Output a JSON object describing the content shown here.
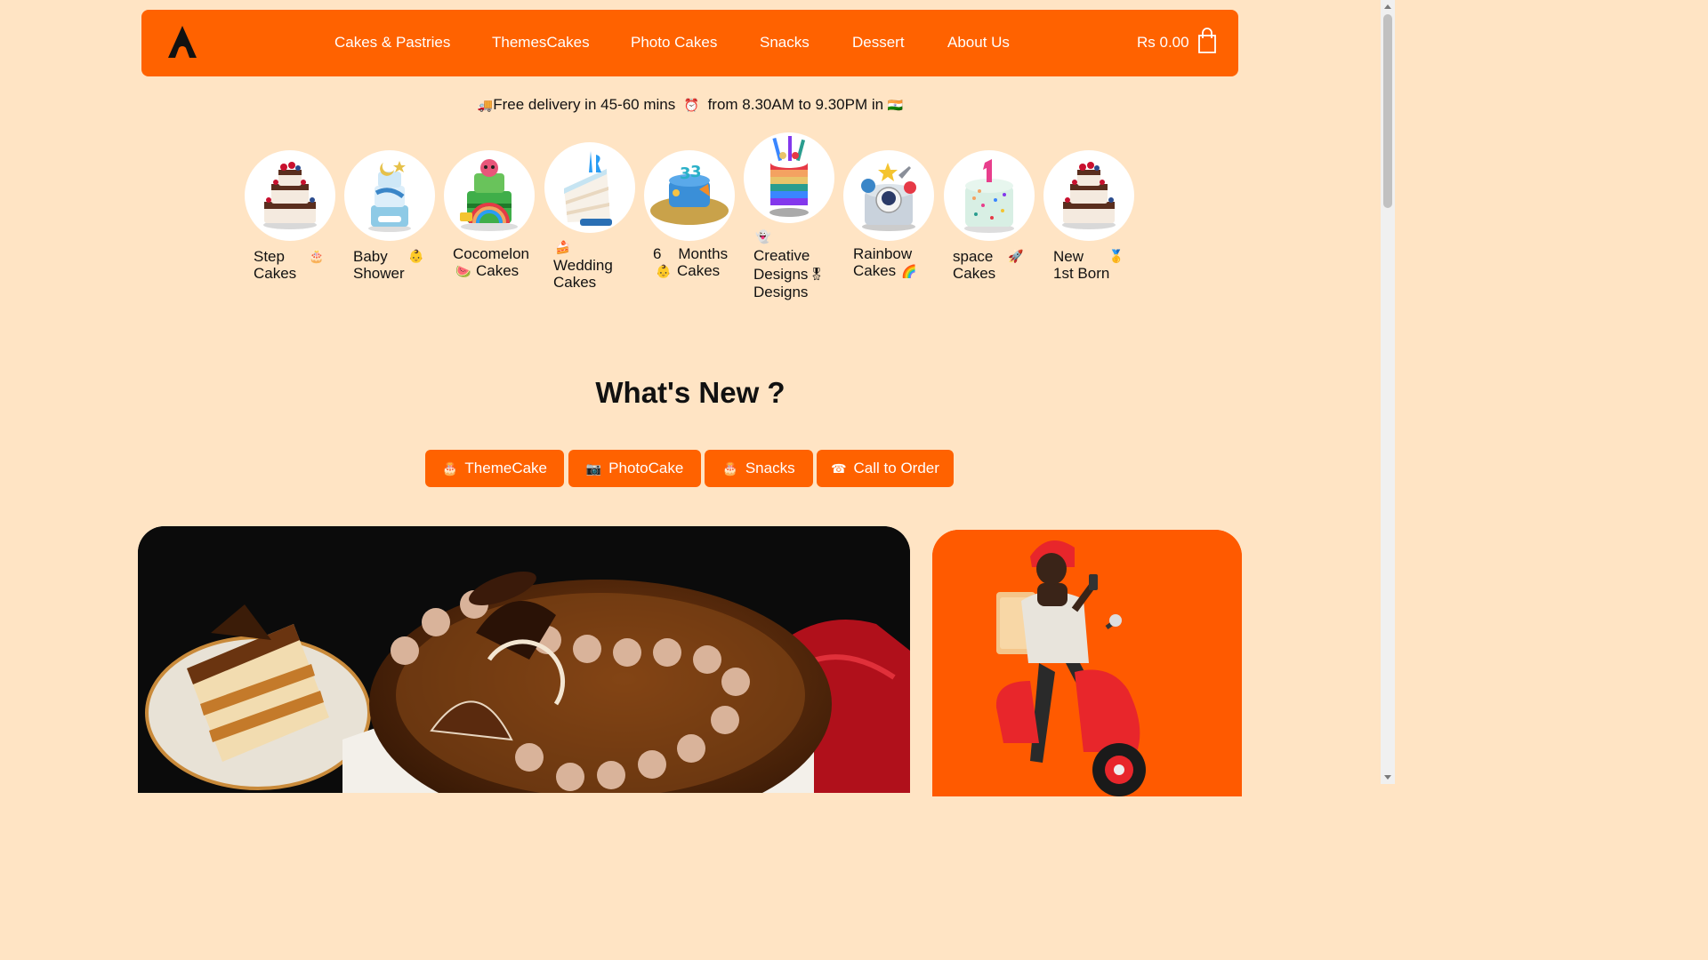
{
  "nav": {
    "logo": "A",
    "items": [
      "Cakes & Pastries",
      "ThemesCakes",
      "Photo Cakes",
      "Snacks",
      "Dessert",
      "About Us"
    ],
    "cart_total": "Rs 0.00"
  },
  "delivery": {
    "truck_emoji": "🚚",
    "text1": "Free delivery in 45-60 mins",
    "clock_emoji": "⏰",
    "text2": "from 8.30AM to 9.30PM in",
    "flag_emoji": "🇮🇳"
  },
  "categories": [
    {
      "line1": "Step",
      "line2": "Cakes",
      "emoji": "🎂"
    },
    {
      "line1": "Baby",
      "line2": "Shower",
      "emoji": "👶"
    },
    {
      "line1": "Cocomelon",
      "line2": "Cakes",
      "emoji": "🍉"
    },
    {
      "line1": "Wedding",
      "line2": "Cakes",
      "emoji": "🍰"
    },
    {
      "line1": "6    Months",
      "line2": "Cakes",
      "emoji": "👶"
    },
    {
      "line1": "Creative",
      "line2": "Designs",
      "line3": "Designs",
      "emoji": "👻",
      "emoji2": "🎖"
    },
    {
      "line1": "Rainbow",
      "line2": "Cakes",
      "emoji": "🌈"
    },
    {
      "line1": "space",
      "line2": "Cakes",
      "emoji": "🚀"
    },
    {
      "line1": "New",
      "line2": "1st Born",
      "emoji": "🥇"
    }
  ],
  "section": {
    "title": "What's New ?"
  },
  "pills": [
    {
      "emoji": "🎂",
      "label": "ThemeCake"
    },
    {
      "emoji": "📷",
      "label": "PhotoCake"
    },
    {
      "emoji": "🎂",
      "label": "Snacks"
    },
    {
      "emoji": "☎",
      "label": "Call to Order"
    }
  ],
  "colors": {
    "brand": "#ff6200",
    "background": "#ffe4c4"
  }
}
